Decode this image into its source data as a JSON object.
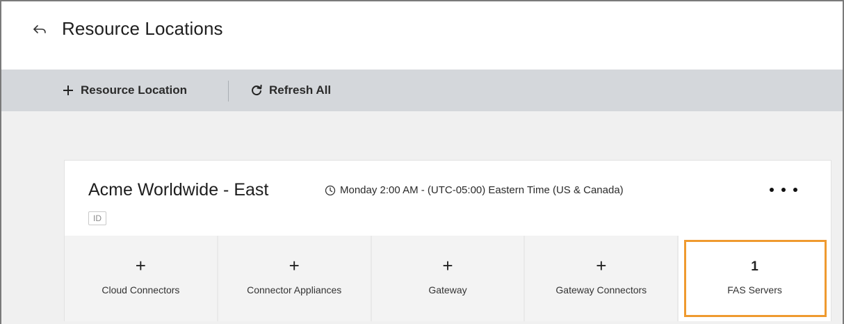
{
  "header": {
    "title": "Resource Locations",
    "back_icon": "back-arrow-icon"
  },
  "toolbar": {
    "add_label": "Resource Location",
    "add_icon": "plus-icon",
    "refresh_label": "Refresh All",
    "refresh_icon": "refresh-icon"
  },
  "card": {
    "name": "Acme Worldwide - East",
    "schedule": "Monday 2:00 AM - (UTC-05:00) Eastern Time (US & Canada)",
    "schedule_icon": "clock-icon",
    "badge": "ID",
    "more_icon": "more-icon",
    "tiles": [
      {
        "top": "+",
        "label": "Cloud Connectors"
      },
      {
        "top": "+",
        "label": "Connector Appliances"
      },
      {
        "top": "+",
        "label": "Gateway"
      },
      {
        "top": "+",
        "label": "Gateway Connectors"
      },
      {
        "top": "1",
        "label": "FAS Servers"
      }
    ]
  },
  "colors": {
    "toolbar_bg": "#d4d7db",
    "highlight": "#ef9a2f"
  }
}
